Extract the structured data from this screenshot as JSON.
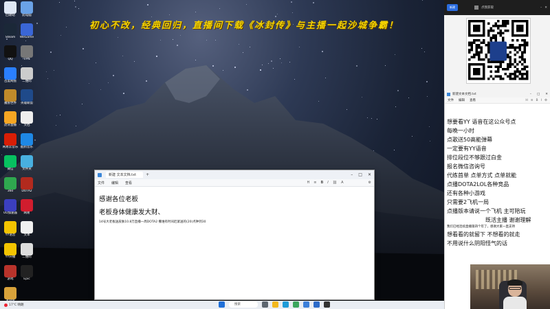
{
  "banner": {
    "text": "初心不改，经典回归，直播间下载《冰封传》与主播一起沙城争霸！"
  },
  "desktop_icons": [
    {
      "label": "回收站",
      "icon": "recycle-bin-icon",
      "color": "#dfe8f5"
    },
    {
      "label": "此电脑",
      "icon": "computer-icon",
      "color": "#6aa2e6"
    },
    {
      "label": "Steam",
      "icon": "steam-icon",
      "color": "#1b2838"
    },
    {
      "label": "WeGame",
      "icon": "wegame-icon",
      "color": "#3a66d6"
    },
    {
      "label": "QQ",
      "icon": "qq-icon",
      "color": "#111111"
    },
    {
      "label": "VPN",
      "icon": "globe-icon",
      "color": "#777777"
    },
    {
      "label": "百度网盘",
      "icon": "cloud-icon",
      "color": "#2a7fff"
    },
    {
      "label": "二维码",
      "icon": "qr-icon",
      "color": "#cccccc"
    },
    {
      "label": "魔兽世界",
      "icon": "wow-icon",
      "color": "#c08a2a"
    },
    {
      "label": "英雄联盟",
      "icon": "lol-icon",
      "color": "#1f4a8a"
    },
    {
      "label": "虎牙直播",
      "icon": "huya-icon",
      "color": "#f5a623"
    },
    {
      "label": "文档",
      "icon": "document-icon",
      "color": "#eeeeee"
    },
    {
      "label": "网易云音乐",
      "icon": "music-icon",
      "color": "#d81e06"
    },
    {
      "label": "酷狗音乐",
      "icon": "kugou-icon",
      "color": "#1e88e5"
    },
    {
      "label": "微信",
      "icon": "wechat-icon",
      "color": "#07c160"
    },
    {
      "label": "文件夹",
      "icon": "folder-icon",
      "color": "#48b0e0"
    },
    {
      "label": "360",
      "icon": "shield-icon",
      "color": "#2fa84f"
    },
    {
      "label": "DOTA2",
      "icon": "dota-icon",
      "color": "#b22a1e"
    },
    {
      "label": "UU加速器",
      "icon": "accelerator-icon",
      "color": "#3b3fbf"
    },
    {
      "label": "网易",
      "icon": "netease-icon",
      "color": "#d11d2e"
    },
    {
      "label": "YY语音",
      "icon": "yy-icon",
      "color": "#f3c400"
    },
    {
      "label": "文本",
      "icon": "text-file-icon",
      "color": "#f0f0f0"
    },
    {
      "label": "YY开播",
      "icon": "yy-live-icon",
      "color": "#f3c400"
    },
    {
      "label": "二维码",
      "icon": "qr-icon",
      "color": "#dddddd"
    },
    {
      "label": "游戏",
      "icon": "game-icon",
      "color": "#b8332b"
    },
    {
      "label": "Epic",
      "icon": "epic-icon",
      "color": "#222222"
    },
    {
      "label": "冰封传",
      "icon": "game-launcher-icon",
      "color": "#d8a23a"
    }
  ],
  "notepad": {
    "tab_title": "新建 文本文档.txt",
    "menu": [
      "文件",
      "编辑",
      "查看"
    ],
    "line1": "感谢各位老板",
    "line2": "老板身体健康发大财、",
    "line3": "14号大老板送皮肤10.8万直播一周DOTA2 撒谁有时间赶紧送的(20)点钟到30"
  },
  "taskbar": {
    "weather": "17°C 晴朗",
    "search_placeholder": "搜索"
  },
  "right_panel": {
    "top_tag": "新建",
    "top_label": "点我获取"
  },
  "chat": {
    "title": "新建文本文档.txt",
    "menu": [
      "文件",
      "编辑",
      "查看"
    ],
    "lines": [
      {
        "text": "想要看YY 语音在这公众号点",
        "style": "normal"
      },
      {
        "text": "每晚一小时",
        "style": "normal"
      },
      {
        "text": "点歌送50高能弹幕",
        "style": "normal"
      },
      {
        "text": "一定要有YY语音",
        "style": "normal"
      },
      {
        "text": "排位段位不够跟过白金",
        "style": "normal"
      },
      {
        "text": "报名微信咨询号",
        "style": "normal"
      },
      {
        "text": "代练首单 点单方式 点单就能",
        "style": "normal"
      },
      {
        "text": "点播DOTA2LOL各种竞品",
        "style": "normal"
      },
      {
        "text": "还有各种小游戏",
        "style": "normal"
      },
      {
        "text": "只需要2飞机一局",
        "style": "normal"
      },
      {
        "text": "点播版本请说一个飞机 主可陪玩",
        "style": "normal"
      },
      {
        "text": "既活主播 谢谢理解",
        "style": "indent"
      },
      {
        "text": "我们已经连续直播第四个年了，感谢大家一直支持",
        "style": "small"
      },
      {
        "text": "想看看的就留下 不想看的就走",
        "style": "normal"
      },
      {
        "text": "不用说什么阴阳怪气的话",
        "style": "normal"
      }
    ]
  }
}
